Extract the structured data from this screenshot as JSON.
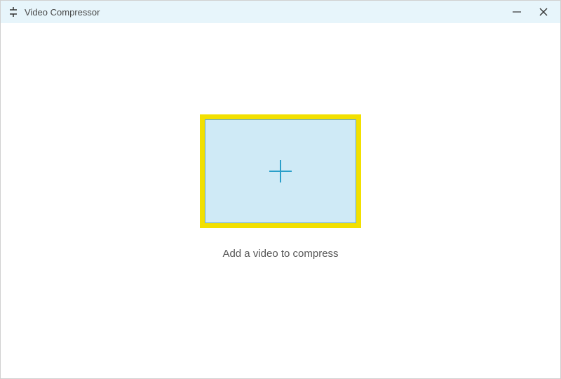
{
  "window": {
    "title": "Video Compressor"
  },
  "main": {
    "prompt": "Add a video to compress"
  },
  "icons": {
    "app": "compress-icon",
    "minimize": "minimize-icon",
    "close": "close-icon",
    "plus": "plus-icon"
  },
  "colors": {
    "titlebar_bg": "#e7f5fb",
    "dropzone_border": "#f2e000",
    "dropzone_fill": "#cfeaf6",
    "plus_stroke": "#2a9fc9"
  }
}
